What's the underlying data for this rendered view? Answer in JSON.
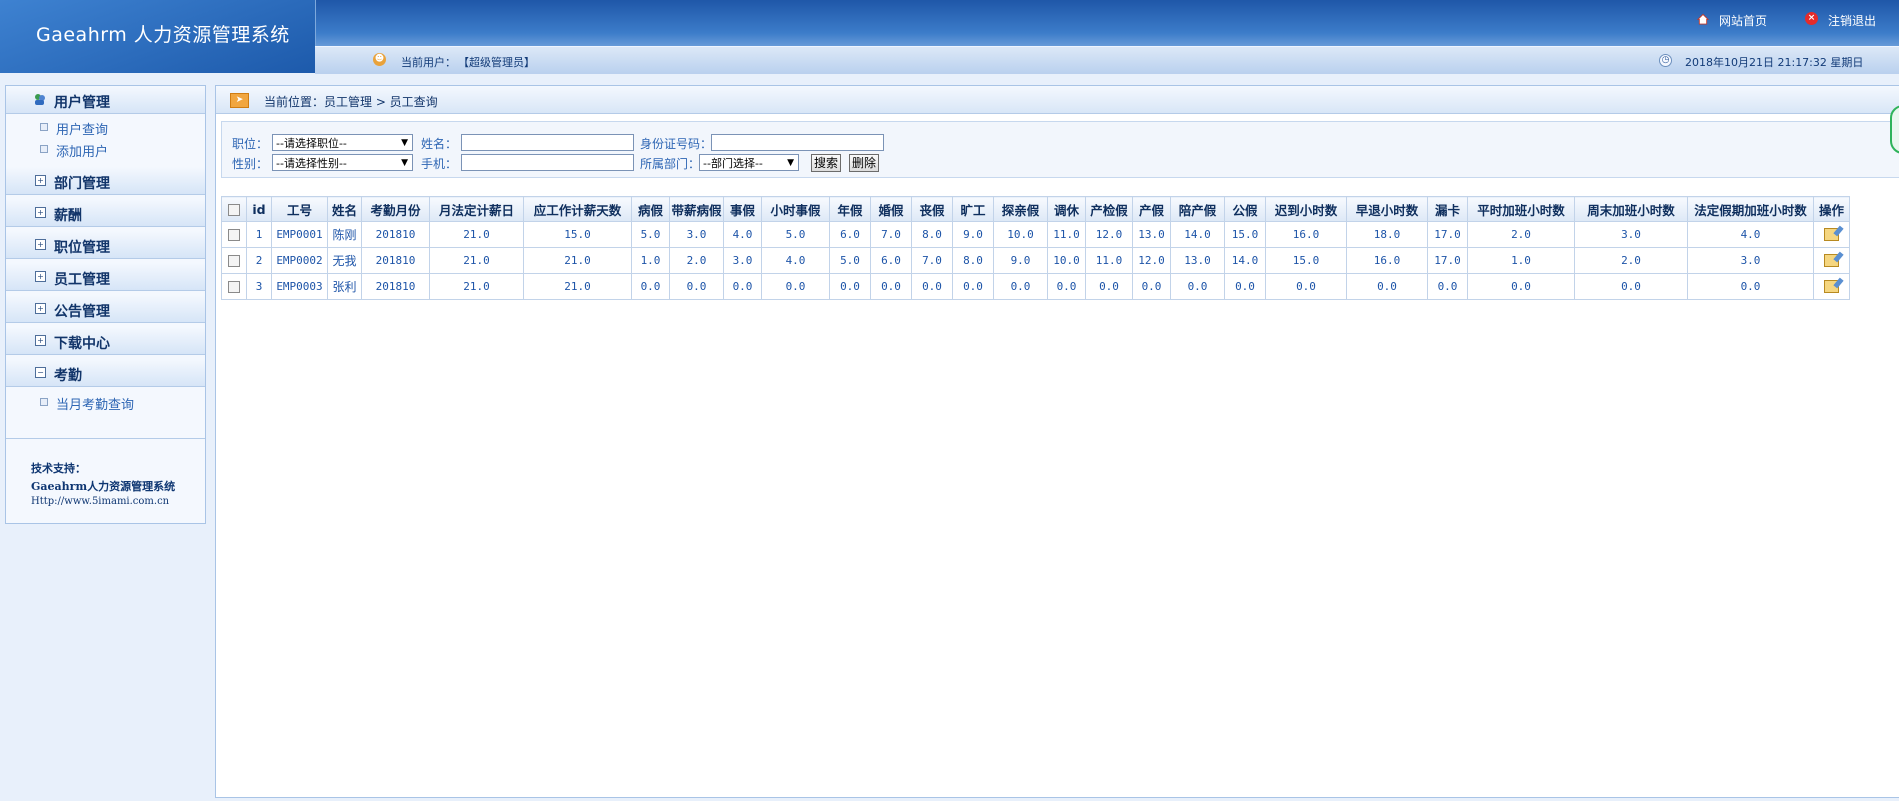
{
  "header": {
    "app_title": "Gaeahrm 人力资源管理系统",
    "current_user_label": "当前用户：",
    "current_user_name": "【超级管理员】",
    "datetime": "2018年10月21日 21:17:32 星期日",
    "home_label": "网站首页",
    "logout_label": "注销退出"
  },
  "sidebar": {
    "groups": [
      {
        "label": "用户管理",
        "expanded": true,
        "items": [
          "用户查询",
          "添加用户"
        ]
      },
      {
        "label": "部门管理",
        "expanded": false
      },
      {
        "label": "薪酬",
        "expanded": false
      },
      {
        "label": "职位管理",
        "expanded": false
      },
      {
        "label": "员工管理",
        "expanded": false
      },
      {
        "label": "公告管理",
        "expanded": false
      },
      {
        "label": "下载中心",
        "expanded": false
      },
      {
        "label": "考勤",
        "expanded": true,
        "items": [
          "当月考勤查询"
        ]
      }
    ],
    "tech_support_title": "技术支持：",
    "tech_support_name": "Gaeahrm人力资源管理系统",
    "tech_support_url": "Http://www.5imami.com.cn"
  },
  "breadcrumb": "当前位置：员工管理 > 员工查询",
  "filters": {
    "position_label": "职位：",
    "position_value": "--请选择职位--",
    "name_label": "姓名：",
    "id_label": "身份证号码：",
    "gender_label": "性别：",
    "gender_value": "--请选择性别--",
    "phone_label": "手机：",
    "dept_label": "所属部门：",
    "dept_value": "--部门选择--",
    "search_button": "搜索",
    "delete_button": "删除"
  },
  "table": {
    "columns": [
      "id",
      "工号",
      "姓名",
      "考勤月份",
      "月法定计薪日",
      "应工作计薪天数",
      "病假",
      "带薪病假",
      "事假",
      "小时事假",
      "年假",
      "婚假",
      "丧假",
      "旷工",
      "探亲假",
      "调休",
      "产检假",
      "产假",
      "陪产假",
      "公假",
      "迟到小时数",
      "早退小时数",
      "漏卡",
      "平时加班小时数",
      "周末加班小时数",
      "法定假期加班小时数",
      "操作"
    ],
    "rows": [
      [
        "1",
        "EMP0001",
        "陈刚",
        "201810",
        "21.0",
        "15.0",
        "5.0",
        "3.0",
        "4.0",
        "5.0",
        "6.0",
        "7.0",
        "8.0",
        "9.0",
        "10.0",
        "11.0",
        "12.0",
        "13.0",
        "14.0",
        "15.0",
        "16.0",
        "18.0",
        "17.0",
        "2.0",
        "3.0",
        "4.0"
      ],
      [
        "2",
        "EMP0002",
        "无我",
        "201810",
        "21.0",
        "21.0",
        "1.0",
        "2.0",
        "3.0",
        "4.0",
        "5.0",
        "6.0",
        "7.0",
        "8.0",
        "9.0",
        "10.0",
        "11.0",
        "12.0",
        "13.0",
        "14.0",
        "15.0",
        "16.0",
        "17.0",
        "1.0",
        "2.0",
        "3.0"
      ],
      [
        "3",
        "EMP0003",
        "张利",
        "201810",
        "21.0",
        "21.0",
        "0.0",
        "0.0",
        "0.0",
        "0.0",
        "0.0",
        "0.0",
        "0.0",
        "0.0",
        "0.0",
        "0.0",
        "0.0",
        "0.0",
        "0.0",
        "0.0",
        "0.0",
        "0.0",
        "0.0",
        "0.0",
        "0.0",
        "0.0"
      ]
    ]
  },
  "colors": {
    "header_dark": "#1f57a8",
    "link_blue": "#2e66b4",
    "table_text": "#1d54a8",
    "border": "#c2d3e9"
  },
  "icons": {
    "home": "home-icon",
    "logout": "close-circle-icon",
    "user": "user-icon",
    "clock": "clock-icon",
    "edit": "edit-icon"
  }
}
